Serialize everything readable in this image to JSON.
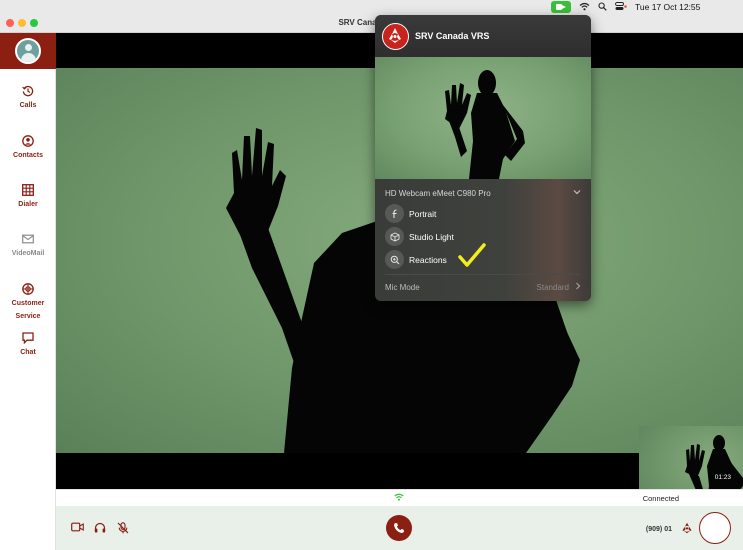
{
  "window": {
    "title": "SRV Canada VRS"
  },
  "menubar": {
    "date_time": "Tue 17 Oct  12:55"
  },
  "sidebar": {
    "items": [
      {
        "label": "Calls"
      },
      {
        "label": "Contacts"
      },
      {
        "label": "Dialer"
      },
      {
        "label": "VideoMail"
      },
      {
        "label": "Customer"
      },
      {
        "label": "Service"
      },
      {
        "label": "Chat"
      }
    ]
  },
  "popup": {
    "app_name": "SRV Canada VRS",
    "device": "HD Webcam eMeet C980 Pro",
    "effects": [
      {
        "label": "Portrait",
        "icon": "portrait-icon"
      },
      {
        "label": "Studio Light",
        "icon": "studio-light-icon"
      },
      {
        "label": "Reactions",
        "icon": "reactions-icon"
      }
    ],
    "mic_mode_label": "Mic Mode",
    "mic_mode_value": "Standard"
  },
  "selfview": {
    "timer": "01:23"
  },
  "status": {
    "connection": "Connected"
  },
  "toolbar": {
    "phone_number": "(909) 01"
  },
  "colors": {
    "brand": "#8b1f12",
    "accent_red": "#c8231c",
    "check_yellow": "#f2ee1c",
    "camera_indicator": "#3bbf3a"
  }
}
